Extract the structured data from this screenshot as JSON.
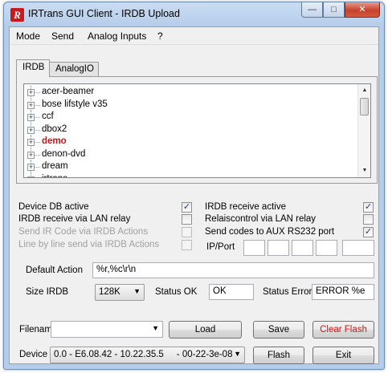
{
  "window": {
    "title": "IRTrans GUI Client - IRDB Upload"
  },
  "menu": [
    "Mode",
    "Send",
    "Analog Inputs",
    "?"
  ],
  "tabs": [
    "IRDB",
    "AnalogIO"
  ],
  "tree": {
    "items": [
      "acer-beamer",
      "bose lifstyle v35",
      "ccf",
      "dbox2",
      "demo",
      "denon-dvd",
      "dream",
      "irtrans"
    ],
    "selected": "demo"
  },
  "options": {
    "device_db_active": {
      "label": "Device DB active",
      "checked": true
    },
    "irdb_receive_lan_relay": {
      "label": "IRDB receive via LAN relay",
      "checked": false
    },
    "send_ir_code": {
      "label": "Send IR Code via IRDB Actions",
      "checked": false
    },
    "line_by_line": {
      "label": "Line by line send via IRDB Actions",
      "checked": false
    },
    "irdb_receive_active": {
      "label": "IRDB receive active",
      "checked": true
    },
    "relaiscontrol": {
      "label": "Relaiscontrol via LAN relay",
      "checked": false
    },
    "send_codes_aux": {
      "label": "Send codes to AUX RS232 port",
      "checked": true
    },
    "ip_port_label": "IP/Port"
  },
  "default_action": {
    "label": "Default Action",
    "value": "%r,%c\\r\\n"
  },
  "size_irdb": {
    "label": "Size IRDB",
    "value": "128K"
  },
  "status_ok": {
    "label": "Status OK",
    "value": "OK"
  },
  "status_error": {
    "label": "Status Error",
    "value": "ERROR %e"
  },
  "filename": {
    "label": "Filenam",
    "value": ""
  },
  "buttons": {
    "load": "Load",
    "save": "Save",
    "clear_flash": "Clear Flash",
    "flash": "Flash",
    "exit": "Exit"
  },
  "device": {
    "label": "Device",
    "value": "0.0 - E6.08.42 - 10.22.35.5     - 00-22-3e-08"
  },
  "icons": {
    "app": "irtrans-logo-icon",
    "minimize": "minimize-icon",
    "maximize": "maximize-icon",
    "close": "close-icon",
    "check": "checkmark-icon",
    "dropdown": "chevron-down-icon"
  }
}
